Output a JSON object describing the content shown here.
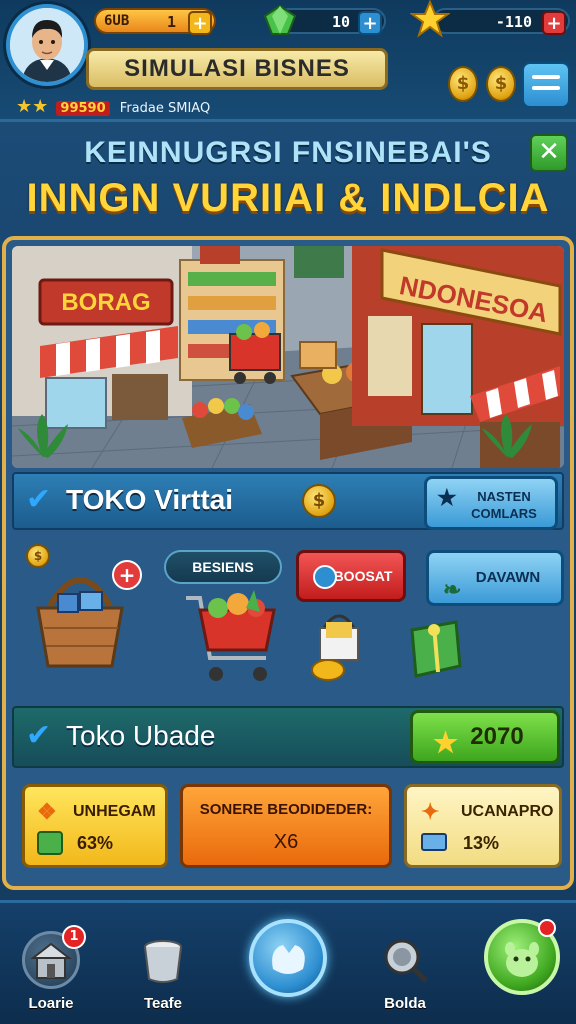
{
  "header": {
    "game_title": "SIMULASI BISNES",
    "level_text": "99590",
    "player_subtitle": "Fradae SMIAQ",
    "star_count": 2
  },
  "resources": {
    "gold": {
      "label": "6UB",
      "value": "1",
      "plus": "+"
    },
    "gems": {
      "value": "10",
      "plus": "+"
    },
    "stars": {
      "value": "-110",
      "plus": "+"
    }
  },
  "headline": {
    "line1": "KEINNUGRSI FNSINEBAI'S",
    "line2": "INNGN VURIIAI & INDLCIA"
  },
  "scene": {
    "sign_left": "BORAG",
    "sign_right": "NDONESOA"
  },
  "shop_row": {
    "title": "TOKO Virttai",
    "coin_symbol": "$",
    "action_button": "NASTEN COMLARS"
  },
  "shop_actions": {
    "tag_label": "BESIENS",
    "plus": "+",
    "red_button": "BOOSAT",
    "blue_button": "DAVAWN",
    "coin_symbol": "$"
  },
  "upgrade_row": {
    "title": "Toko Ubade",
    "value_button": "2070"
  },
  "upgrade_cards": [
    {
      "title": "UNHEGAM",
      "value": "63%"
    },
    {
      "title": "SONERE BEODIDEDER:",
      "value": "X6"
    },
    {
      "title": "UCANAPRO",
      "value": "13%"
    }
  ],
  "bottom_nav": [
    {
      "label": "Loarie",
      "badge": "1"
    },
    {
      "label": "Teafe",
      "badge": ""
    },
    {
      "label": "",
      "badge": ""
    },
    {
      "label": "Bolda",
      "badge": ""
    },
    {
      "label": "",
      "badge": ""
    }
  ],
  "colors": {
    "gold_accent": "#e2b04a",
    "headline_yellow": "#ffd53a",
    "primary_blue": "#2d8ed0",
    "red": "#c21d1d",
    "green": "#3ea61e"
  }
}
